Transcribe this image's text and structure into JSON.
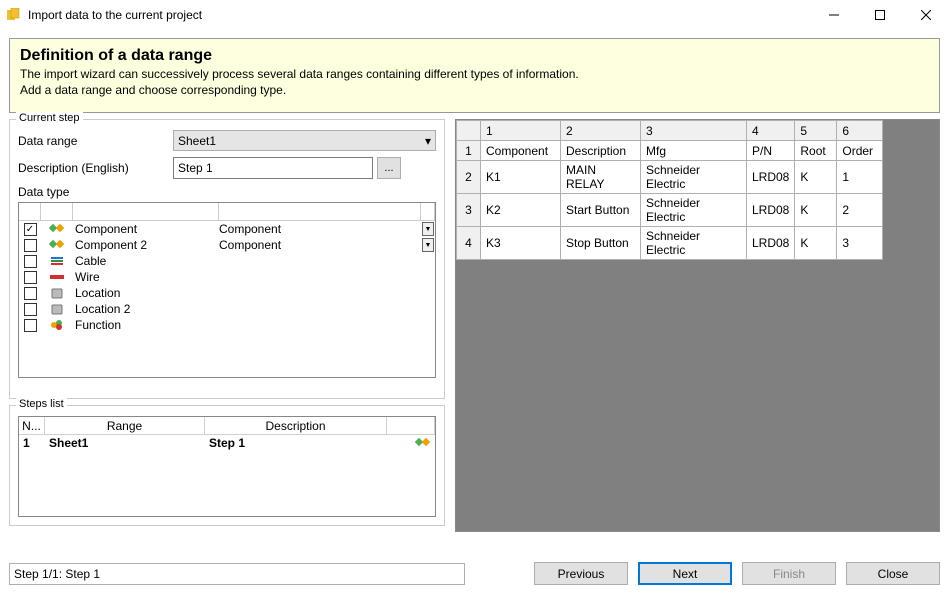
{
  "window": {
    "title": "Import data to the current project"
  },
  "info": {
    "heading": "Definition of a data range",
    "line1": "The import wizard can successively process several data ranges containing different types of information.",
    "line2": "Add a data range and choose corresponding type."
  },
  "current_step": {
    "group_label": "Current step",
    "data_range_label": "Data range",
    "data_range_value": "Sheet1",
    "description_label": "Description (English)",
    "description_value": "Step 1",
    "browse_label": "...",
    "data_type_label": "Data type",
    "types": [
      {
        "checked": true,
        "icon": "component",
        "name": "Component",
        "mapped": "Component",
        "has_dd": true
      },
      {
        "checked": false,
        "icon": "component",
        "name": "Component 2",
        "mapped": "Component",
        "has_dd": true
      },
      {
        "checked": false,
        "icon": "cable",
        "name": "Cable",
        "mapped": "",
        "has_dd": false
      },
      {
        "checked": false,
        "icon": "wire",
        "name": "Wire",
        "mapped": "",
        "has_dd": false
      },
      {
        "checked": false,
        "icon": "location",
        "name": "Location",
        "mapped": "",
        "has_dd": false
      },
      {
        "checked": false,
        "icon": "location",
        "name": "Location 2",
        "mapped": "",
        "has_dd": false
      },
      {
        "checked": false,
        "icon": "function",
        "name": "Function",
        "mapped": "",
        "has_dd": false
      }
    ]
  },
  "steps_list": {
    "group_label": "Steps list",
    "headers": {
      "num": "N...",
      "range": "Range",
      "desc": "Description"
    },
    "rows": [
      {
        "num": "1",
        "range": "Sheet1",
        "desc": "Step 1"
      }
    ]
  },
  "preview": {
    "col_headers": [
      "1",
      "2",
      "3",
      "4",
      "5",
      "6"
    ],
    "rows": [
      {
        "num": "1",
        "cells": [
          "Component",
          "Description",
          "Mfg",
          "P/N",
          "Root",
          "Order"
        ]
      },
      {
        "num": "2",
        "cells": [
          "K1",
          "MAIN RELAY",
          "Schneider Electric",
          "LRD08",
          "K",
          "1"
        ]
      },
      {
        "num": "3",
        "cells": [
          "K2",
          "Start Button",
          "Schneider Electric",
          "LRD08",
          "K",
          "2"
        ]
      },
      {
        "num": "4",
        "cells": [
          "K3",
          "Stop Button",
          "Schneider Electric",
          "LRD08",
          "K",
          "3"
        ]
      }
    ]
  },
  "status": "Step 1/1: Step 1",
  "buttons": {
    "previous": "Previous",
    "next": "Next",
    "finish": "Finish",
    "close": "Close"
  }
}
